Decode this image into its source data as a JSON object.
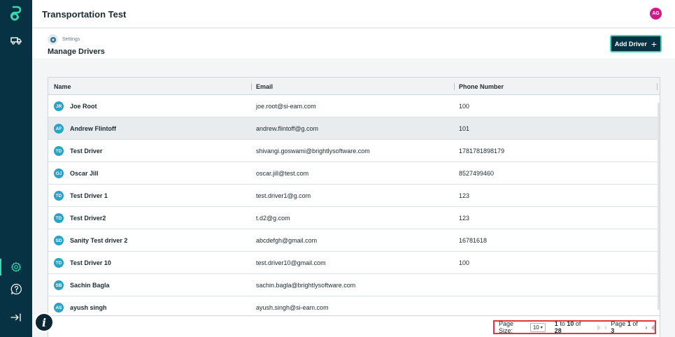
{
  "header": {
    "app_title": "Transportation Test",
    "user_initials": "AG"
  },
  "breadcrumb": {
    "parent": "Settings"
  },
  "page": {
    "title": "Manage Drivers",
    "add_button": "Add Driver"
  },
  "table": {
    "columns": {
      "name": "Name",
      "email": "Email",
      "phone": "Phone Number"
    },
    "rows": [
      {
        "initials": "JR",
        "name": "Joe Root",
        "email": "joe.root@si-eam.com",
        "phone": "100"
      },
      {
        "initials": "AF",
        "name": "Andrew Flintoff",
        "email": "andrew.flintoff@g.com",
        "phone": "101"
      },
      {
        "initials": "TD",
        "name": "Test Driver",
        "email": "shivangi.goswami@brightlysoftware.com",
        "phone": "1781781898179"
      },
      {
        "initials": "OJ",
        "name": "Oscar Jill",
        "email": "oscar.jill@test.com",
        "phone": "8527499460"
      },
      {
        "initials": "TD",
        "name": "Test Driver 1",
        "email": "test.driver1@g.com",
        "phone": "123"
      },
      {
        "initials": "TD",
        "name": "Test Driver2",
        "email": "t.d2@g.com",
        "phone": "123"
      },
      {
        "initials": "SD",
        "name": "Sanity Test driver 2",
        "email": "abcdefgh@gmail.com",
        "phone": "16781618"
      },
      {
        "initials": "TD",
        "name": "Test Driver 10",
        "email": "test.driver10@gmail.com",
        "phone": "100"
      },
      {
        "initials": "SB",
        "name": "Sachin Bagla",
        "email": "sachin.bagla@brightlysoftware.com",
        "phone": ""
      },
      {
        "initials": "AS",
        "name": "ayush singh",
        "email": "ayush.singh@si-eam.com",
        "phone": ""
      }
    ]
  },
  "pagination": {
    "page_size_label": "Page Size:",
    "page_size_value": "10",
    "range_from": "1",
    "range_to": "10",
    "range_total": "28",
    "to_word": "to",
    "of_word": "of",
    "page_word": "Page",
    "current_page": "1",
    "total_pages": "3"
  },
  "icons": {
    "logo": "brightly-logo-icon",
    "nav_truck": "truck-icon",
    "nav_settings": "gear-icon",
    "nav_help": "help-icon",
    "nav_collapse": "collapse-sidebar-icon",
    "info": "info-icon"
  },
  "colors": {
    "sidebar": "#073243",
    "accent": "#3ed6b1",
    "user_avatar": "#d0188a",
    "driver_avatar": "#2aa3c7",
    "highlight_border": "#e2363c"
  }
}
